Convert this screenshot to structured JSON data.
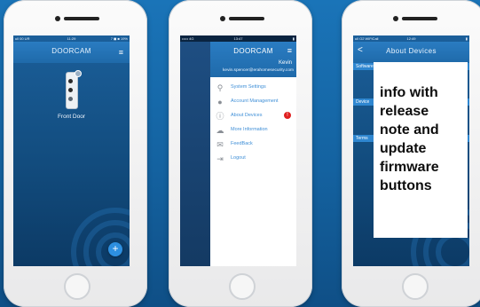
{
  "phone1": {
    "status_left": "ull 00 UR",
    "status_time": "11:29",
    "status_right": "7 ◼ ■ 19%",
    "title": "DOORCAM",
    "device_label": "Front Door",
    "add_button": "+"
  },
  "phone2": {
    "status_left": "••••• 4G",
    "status_time": "13:47",
    "title": "DOORCAM",
    "user_name": "Kevin",
    "user_email": "kevin.spencer@erahomesecurity.com",
    "menu": [
      {
        "label": "System Settings",
        "icon": "key-icon"
      },
      {
        "label": "Account Management",
        "icon": "user-icon"
      },
      {
        "label": "About Devices",
        "icon": "info-icon",
        "alert": "!"
      },
      {
        "label": "More Information",
        "icon": "cloud-icon"
      },
      {
        "label": "FeedBack",
        "icon": "mail-icon"
      },
      {
        "label": "Logout",
        "icon": "logout-icon"
      }
    ]
  },
  "phone3": {
    "status_left": "ull O2 WiFiCall",
    "status_time": "12:49",
    "title": "About Devices",
    "back": "<",
    "section1": "Software information",
    "section2": "Device",
    "section3": "Terms"
  },
  "callout": {
    "text_lines": [
      "info with",
      "release",
      "note and",
      "update",
      "firmware",
      "buttons"
    ]
  },
  "colors": {
    "background": "#1462a0",
    "titlebar": "#2274b8",
    "accent": "#2e86d0",
    "link": "#3f8fd7",
    "alert": "#e02020"
  }
}
